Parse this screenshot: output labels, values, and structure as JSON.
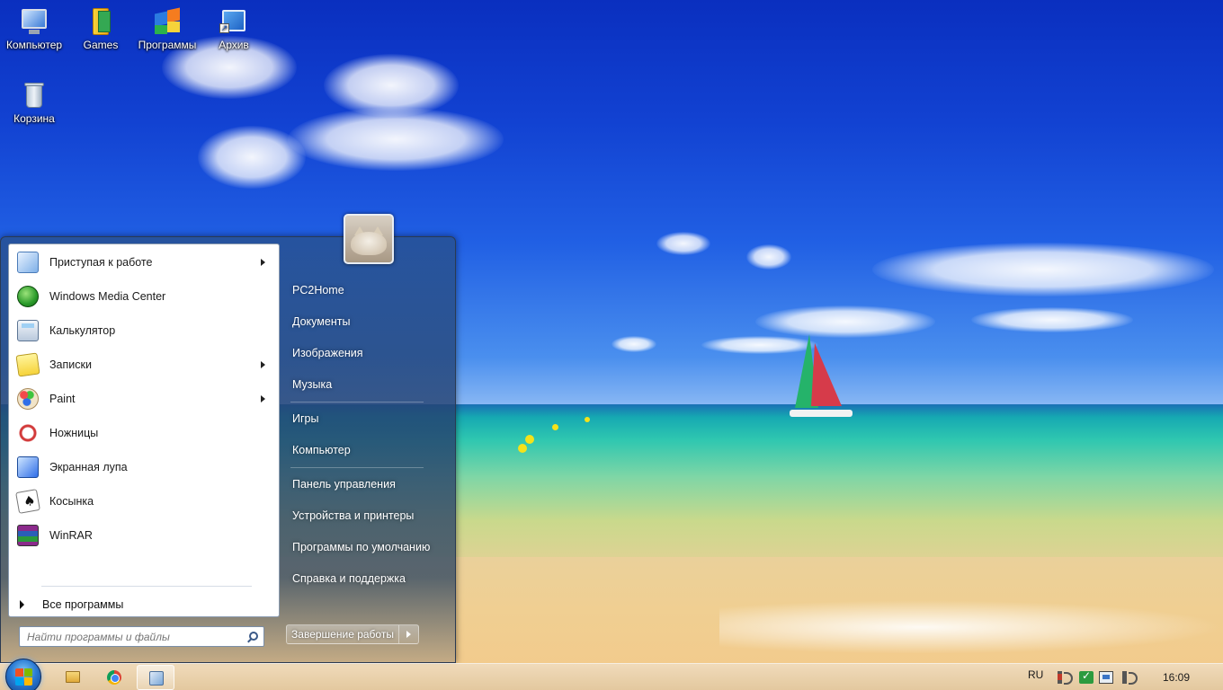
{
  "desktop": {
    "icons": [
      {
        "label": "Компьютер",
        "icon": "computer-icon"
      },
      {
        "label": "Games",
        "icon": "games-icon"
      },
      {
        "label": "Программы",
        "icon": "programs-icon"
      },
      {
        "label": "Архив",
        "icon": "archive-shortcut-icon"
      },
      {
        "label": "Корзина",
        "icon": "recycle-bin-icon"
      }
    ]
  },
  "start_menu": {
    "programs": [
      {
        "label": "Приступая к работе",
        "icon": "getting-started-icon",
        "submenu": true
      },
      {
        "label": "Windows Media Center",
        "icon": "windows-media-center-icon",
        "submenu": false
      },
      {
        "label": "Калькулятор",
        "icon": "calculator-icon",
        "submenu": false
      },
      {
        "label": "Записки",
        "icon": "sticky-notes-icon",
        "submenu": true
      },
      {
        "label": "Paint",
        "icon": "paint-icon",
        "submenu": true
      },
      {
        "label": "Ножницы",
        "icon": "snipping-tool-icon",
        "submenu": false
      },
      {
        "label": "Экранная лупа",
        "icon": "magnifier-icon",
        "submenu": false
      },
      {
        "label": "Косынка",
        "icon": "solitaire-icon",
        "submenu": false
      },
      {
        "label": "WinRAR",
        "icon": "winrar-icon",
        "submenu": false
      }
    ],
    "all_programs_label": "Все программы",
    "search_placeholder": "Найти программы и файлы",
    "right_items": [
      "PC2Home",
      "Документы",
      "Изображения",
      "Музыка",
      "Игры",
      "Компьютер",
      "Панель управления",
      "Устройства и принтеры",
      "Программы по умолчанию",
      "Справка и поддержка"
    ],
    "shutdown_label": "Завершение работы"
  },
  "taskbar": {
    "pinned": [
      "folder-icon",
      "chrome-icon",
      "control-panel-icon"
    ],
    "language": "RU",
    "clock": "16:09"
  }
}
